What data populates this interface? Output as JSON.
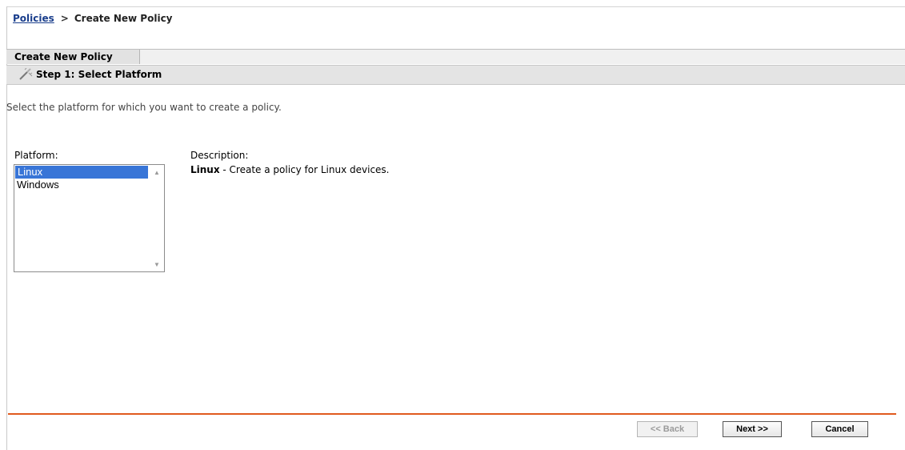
{
  "breadcrumb": {
    "parent_link": "Policies",
    "separator": ">",
    "current": "Create New Policy"
  },
  "panel": {
    "title_tab": "Create New Policy",
    "step_title": "Step 1: Select Platform",
    "step_icon": "wand-icon"
  },
  "instructions": "Select the platform for which you want to create a policy.",
  "platform": {
    "label": "Platform:",
    "options": [
      "Linux",
      "Windows"
    ],
    "selected": "Linux"
  },
  "description": {
    "label": "Description:",
    "name": "Linux",
    "text": " - Create a policy for Linux devices."
  },
  "buttons": {
    "back": "<< Back",
    "next": "Next >>",
    "cancel": "Cancel"
  },
  "colors": {
    "accent_divider": "#e05a1e",
    "selection": "#3875d7",
    "link": "#1a3e8c"
  }
}
